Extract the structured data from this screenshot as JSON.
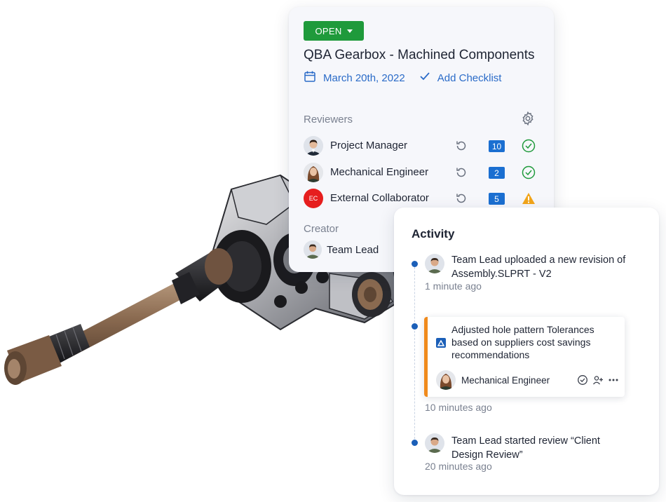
{
  "review": {
    "status_label": "OPEN",
    "title": "QBA Gearbox - Machined Components",
    "date": "March 20th, 2022",
    "add_checklist": "Add Checklist",
    "reviewers_label": "Reviewers",
    "reviewers": [
      {
        "name": "Project Manager",
        "count": "10",
        "status": "approved"
      },
      {
        "name": "Mechanical Engineer",
        "count": "2",
        "status": "approved"
      },
      {
        "name": "External Collaborator",
        "initials": "EC",
        "count": "5",
        "status": "warning"
      }
    ],
    "creator_label": "Creator",
    "creator_name": "Team Lead"
  },
  "activity": {
    "title": "Activity",
    "entries": [
      {
        "text": "Team Lead uploaded a new revision of Assembly.SLPRT - V2",
        "time": "1 minute ago"
      },
      {
        "comment_text": "Adjusted hole pattern Tolerances based on suppliers cost savings recommendations",
        "comment_author": "Mechanical Engineer",
        "time": "10 minutes ago"
      },
      {
        "text": "Team Lead started review “Client Design Review”",
        "time": "20 minutes ago"
      }
    ]
  },
  "colors": {
    "status_green": "#1f9a3b",
    "accent_blue": "#1b6fd1",
    "link_blue": "#2a6bc8",
    "comment_accent": "#f08a1c",
    "warning": "#f2a51a",
    "ec_red": "#e61e1e"
  },
  "icons": [
    "calendar-icon",
    "checkmark-icon",
    "gear-icon",
    "history-icon",
    "check-circle-icon",
    "warning-icon",
    "alert-triangle-icon",
    "add-user-icon",
    "more-icon"
  ]
}
